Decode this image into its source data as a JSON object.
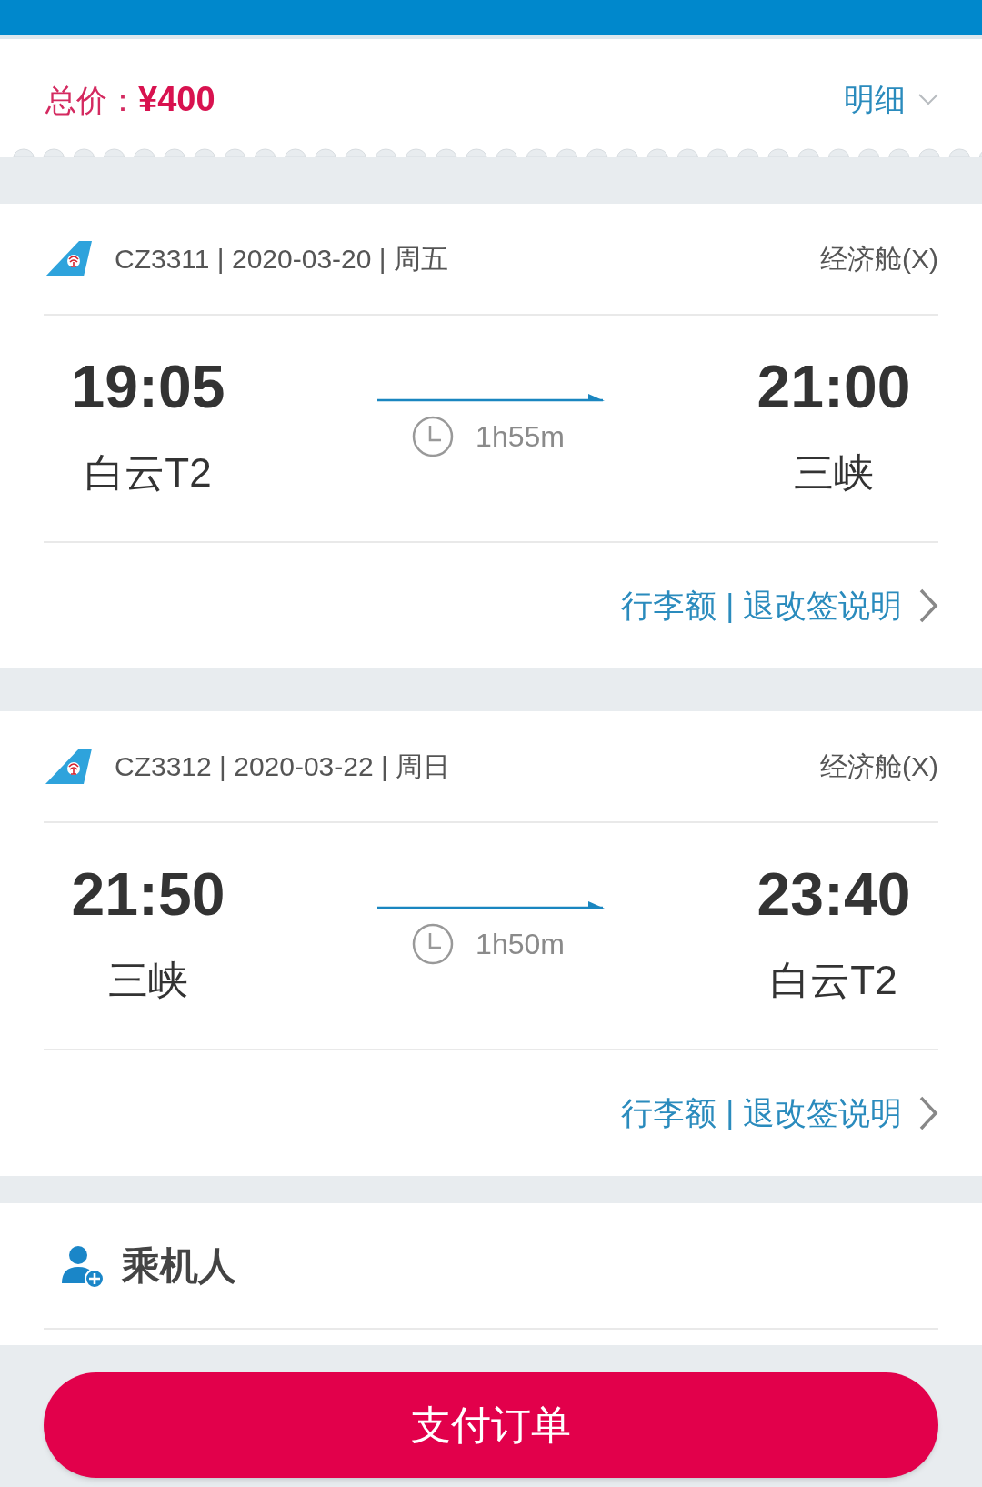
{
  "price_bar": {
    "label": "总价：",
    "amount": "¥400",
    "detail_button": "明细"
  },
  "flights": [
    {
      "flight_info": "CZ3311 | 2020-03-20 | 周五",
      "cabin": "经济舱(X)",
      "departure": {
        "time": "19:05",
        "airport": "白云T2"
      },
      "duration": "1h55m",
      "arrival": {
        "time": "21:00",
        "airport": "三峡"
      },
      "policy_link": "行李额 | 退改签说明"
    },
    {
      "flight_info": "CZ3312 | 2020-03-22 | 周日",
      "cabin": "经济舱(X)",
      "departure": {
        "time": "21:50",
        "airport": "三峡"
      },
      "duration": "1h50m",
      "arrival": {
        "time": "23:40",
        "airport": "白云T2"
      },
      "policy_link": "行李额 | 退改签说明"
    }
  ],
  "passengers": {
    "title": "乘机人"
  },
  "pay_button": {
    "label": "支付订单"
  }
}
